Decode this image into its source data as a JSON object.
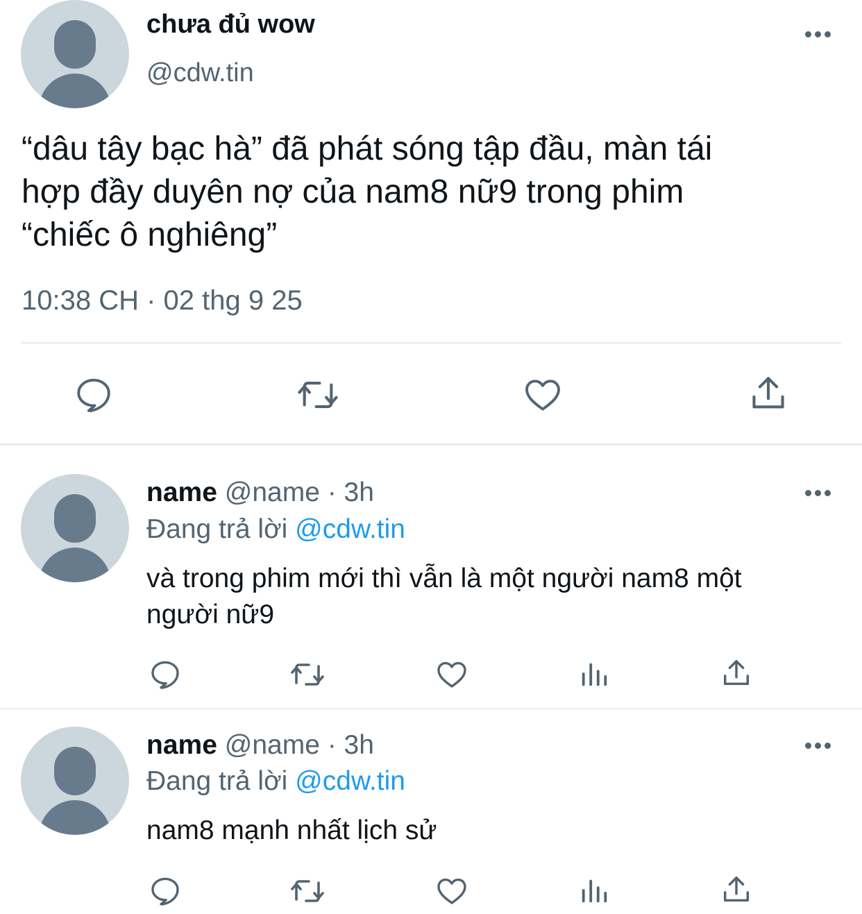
{
  "main_tweet": {
    "display_name": "chưa đủ wow",
    "handle": "@cdw.tin",
    "text_lines": [
      "“dâu tây bạc hà” đã phát sóng tập đầu, màn tái",
      "hợp đầy duyên nợ của nam8 nữ9 trong phim",
      "“chiếc ô nghiêng”"
    ],
    "timestamp": "10:38 CH · 02 thg 9 25"
  },
  "replies": [
    {
      "display_name": "name",
      "meta": "@name · 3h",
      "replying_label": "Đang trả lời",
      "replying_to": "@cdw.tin",
      "text_lines": [
        "và trong phim mới thì vẫn là một người nam8 một",
        "người nữ9"
      ]
    },
    {
      "display_name": "name",
      "meta": "@name · 3h",
      "replying_label": "Đang trả lời",
      "replying_to": "@cdw.tin",
      "text_lines": [
        "nam8 mạnh nhất lịch sử"
      ]
    }
  ],
  "icons": {
    "reply": "reply-icon",
    "retweet": "retweet-icon",
    "like": "like-icon",
    "views": "views-icon",
    "share": "share-icon",
    "more": "more-options-icon",
    "avatar": "default-avatar-icon"
  },
  "colors": {
    "link": "#1d9bf0",
    "secondary_text": "#536471",
    "icon": "#536471",
    "divider": "#e6ecf0"
  }
}
